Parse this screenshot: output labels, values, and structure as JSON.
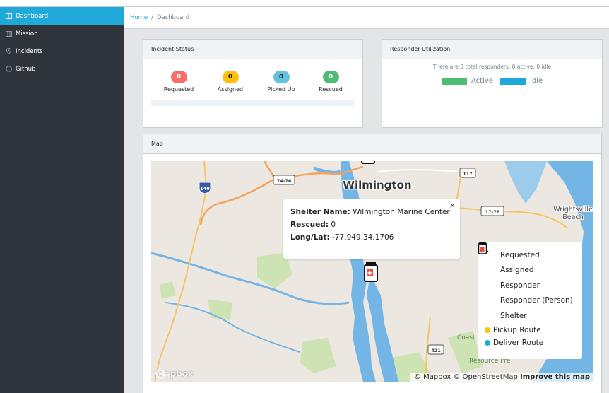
{
  "sidebar": {
    "items": [
      {
        "label": "Dashboard",
        "icon": "dashboard-icon",
        "active": true
      },
      {
        "label": "Mission",
        "icon": "mission-icon"
      },
      {
        "label": "Incidents",
        "icon": "location-pin-icon"
      },
      {
        "label": "Github",
        "icon": "github-icon"
      }
    ]
  },
  "breadcrumb": {
    "home": "Home",
    "separator": "/",
    "current": "Dashboard"
  },
  "incident_status": {
    "title": "Incident Status",
    "stats": [
      {
        "value": "0",
        "label": "Requested",
        "color": "#f86c6b"
      },
      {
        "value": "0",
        "label": "Assigned",
        "color": "#ffc107"
      },
      {
        "value": "0",
        "label": "Picked Up",
        "color": "#63c2de"
      },
      {
        "value": "0",
        "label": "Rescued",
        "color": "#4dbd74"
      }
    ]
  },
  "responder_utilization": {
    "title": "Responder Utilization",
    "summary": "There are 0 total responders. 0 active, 0 idle",
    "legend": [
      {
        "label": "Active",
        "color": "#4dbd74"
      },
      {
        "label": "Idle",
        "color": "#20a8d8"
      }
    ]
  },
  "map": {
    "title": "Map",
    "place_labels": {
      "city": "Wilmington",
      "beach": "Wrightsville Beach",
      "coast": "Coast",
      "resource": "Resource Pre",
      "routes": [
        "140",
        "74-76",
        "117",
        "17-76",
        "421"
      ]
    },
    "popup": {
      "close": "×",
      "shelter_label": "Shelter Name:",
      "shelter_value": "Wilmington Marine Center",
      "rescued_label": "Rescued:",
      "rescued_value": "0",
      "longlat_label": "Long/Lat:",
      "longlat_value": "-77.949,34.1706"
    },
    "legend": [
      {
        "label": "Requested",
        "icon": "requested-pin-icon",
        "color": "#f86c6b"
      },
      {
        "label": "Assigned",
        "icon": "assigned-pin-icon",
        "color": "#ffc107"
      },
      {
        "label": "Responder",
        "icon": "responder-boat-icon"
      },
      {
        "label": "Responder (Person)",
        "icon": "responder-person-icon"
      },
      {
        "label": "Shelter",
        "icon": "shelter-icon"
      },
      {
        "label": "Pickup Route",
        "icon": "pickup-route-dot",
        "color": "#ffc107"
      },
      {
        "label": "Deliver Route",
        "icon": "deliver-route-dot",
        "color": "#20a8d8"
      }
    ],
    "attribution": {
      "mapbox": "© Mapbox",
      "osm": "© OpenStreetMap",
      "improve": "Improve this map"
    },
    "logo": "mapbox"
  }
}
